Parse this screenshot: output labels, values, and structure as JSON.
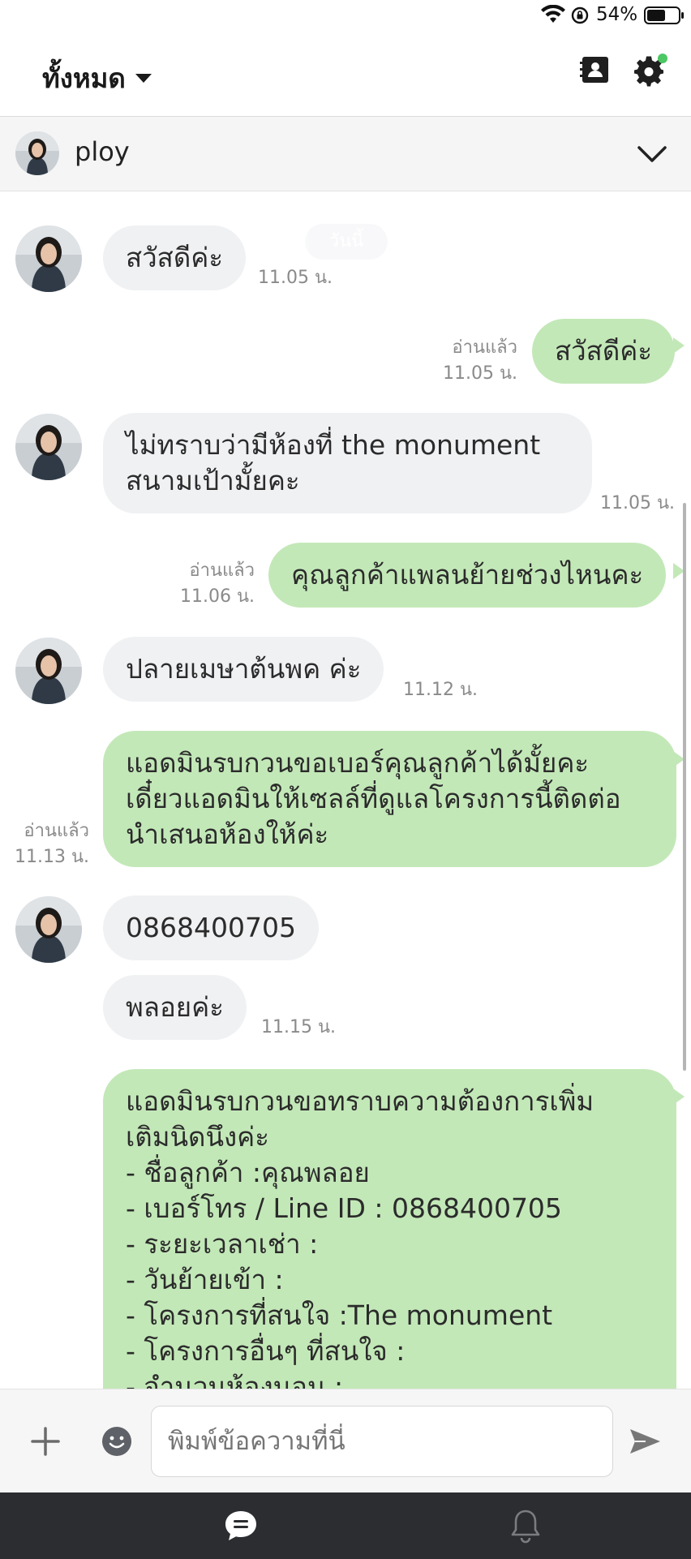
{
  "status_bar": {
    "battery_percent": "54%",
    "icons": [
      "wifi-icon",
      "rotation-lock-icon",
      "battery-icon"
    ]
  },
  "header": {
    "filter_label": "ทั้งหมด",
    "icons": [
      "contacts-icon",
      "settings-icon"
    ],
    "settings_badge_color": "#4cc764"
  },
  "chat": {
    "contact_name": "ploy"
  },
  "date_divider": "วันนี้",
  "messages": [
    {
      "dir": "in",
      "text": "สวัสดีค่ะ",
      "time": "11.05 น."
    },
    {
      "dir": "out",
      "text": "สวัสดีค่ะ",
      "read": "อ่านแล้ว",
      "time": "11.05 น."
    },
    {
      "dir": "in",
      "text": "ไม่ทราบว่ามีห้องที่ the monument\nสนามเป้ามั้ยคะ",
      "time": "11.05 น."
    },
    {
      "dir": "out",
      "text": "คุณลูกค้าแพลนย้ายช่วงไหนคะ",
      "read": "อ่านแล้ว",
      "time": "11.06 น."
    },
    {
      "dir": "in",
      "text": "ปลายเมษาต้นพค ค่ะ",
      "time": "11.12 น."
    },
    {
      "dir": "out",
      "text": "แอดมินรบกวนขอเบอร์คุณลูกค้าได้มั้ยคะ\nเดี๋ยวแอดมินให้เซลล์ที่ดูแลโครงการนี้ติดต่อ\nนำเสนอห้องให้ค่ะ",
      "read": "อ่านแล้ว",
      "time": "11.13 น."
    },
    {
      "dir": "in",
      "text": "0868400705"
    },
    {
      "dir": "in",
      "text": "พลอยค่ะ",
      "time": "11.15 น."
    },
    {
      "dir": "out",
      "text": "แอดมินรบกวนขอทราบความต้องการเพิ่ม\nเติมนิดนึงค่ะ\n- ชื่อลูกค้า :คุณพลอย\n- เบอร์โทร / Line ID : 0868400705\n- ระยะเวลาเช่า :\n- วันย้ายเข้า :\n- โครงการที่สนใจ :The monument\n- โครงการอื่นๆ ที่สนใจ :\n- จำนวนห้องนอน :"
    }
  ],
  "input": {
    "placeholder": "พิมพ์ข้อความที่นี่"
  },
  "colors": {
    "outgoing_bubble": "#c3e8b8",
    "incoming_bubble": "#f0f1f3",
    "tab_bar": "#2b2d30"
  }
}
